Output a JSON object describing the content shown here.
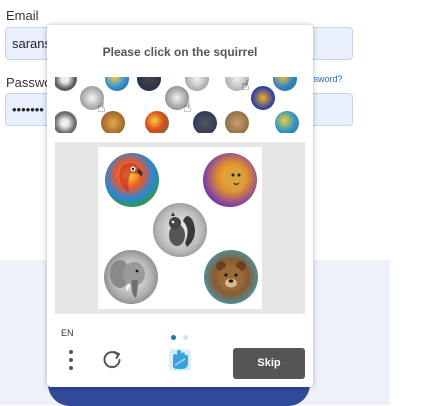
{
  "login": {
    "email_label": "Email",
    "email_value": "sarans",
    "password_label": "Passwo",
    "password_value": "•••••••",
    "forgot_label": "ssword?"
  },
  "captcha": {
    "title": "Please click on the squirrel",
    "language": "EN",
    "skip_label": "Skip",
    "page_indicator": {
      "current": 1,
      "total": 2
    },
    "challenge_animals": [
      "parrot-icon",
      "lion-icon",
      "squirrel-icon",
      "elephant-icon",
      "bear-icon"
    ],
    "colors": {
      "skip_button": "#555555",
      "panel_background": "#e6e6e6",
      "active_dot": "#1a7c9c",
      "inactive_dot": "#d6e4ea",
      "logo": "#36a3e0"
    }
  }
}
